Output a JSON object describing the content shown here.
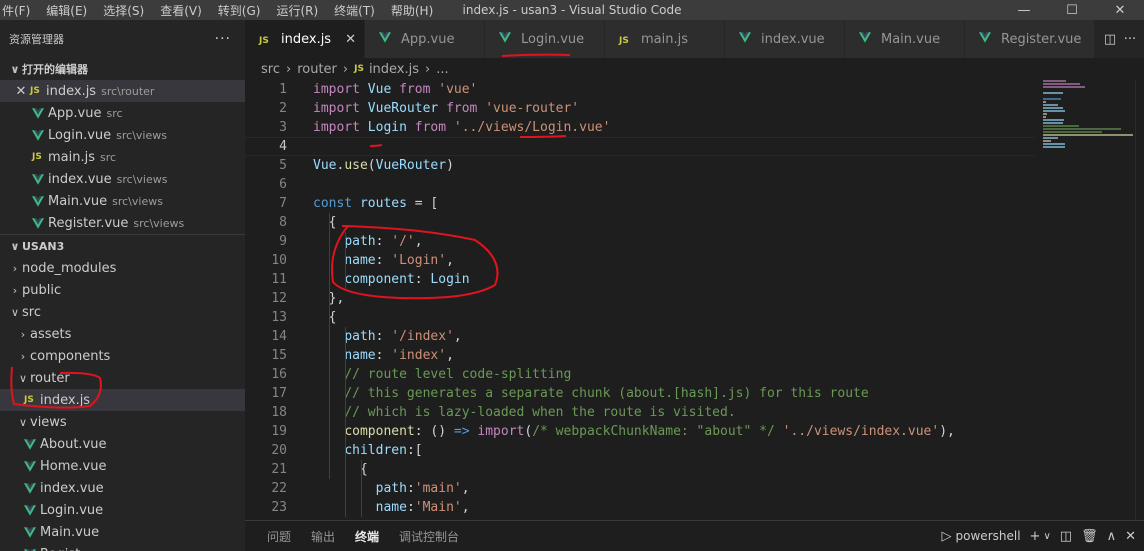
{
  "titlebar": {
    "menu": [
      "件(F)",
      "编辑(E)",
      "选择(S)",
      "查看(V)",
      "转到(G)",
      "运行(R)",
      "终端(T)",
      "帮助(H)"
    ],
    "title": "index.js - usan3 - Visual Studio Code",
    "minimize_icon": "minimize-icon",
    "maximize_icon": "maximize-icon",
    "close_icon": "close-icon"
  },
  "sidebar": {
    "title": "资源管理器",
    "more": "···",
    "open_editors_title": "打开的编辑器",
    "open_editors": [
      {
        "name": "index.js",
        "desc": "src\\router",
        "type": "js"
      },
      {
        "name": "App.vue",
        "desc": "src",
        "type": "vue"
      },
      {
        "name": "Login.vue",
        "desc": "src\\views",
        "type": "vue"
      },
      {
        "name": "main.js",
        "desc": "src",
        "type": "js"
      },
      {
        "name": "index.vue",
        "desc": "src\\views",
        "type": "vue"
      },
      {
        "name": "Main.vue",
        "desc": "src\\views",
        "type": "vue"
      },
      {
        "name": "Register.vue",
        "desc": "src\\views",
        "type": "vue"
      }
    ],
    "project_title": "USAN3",
    "tree": [
      {
        "name": "node_modules",
        "kind": "folder",
        "indent": 0
      },
      {
        "name": "public",
        "kind": "folder",
        "indent": 0
      },
      {
        "name": "src",
        "kind": "folder-open",
        "indent": 0
      },
      {
        "name": "assets",
        "kind": "folder",
        "indent": 1
      },
      {
        "name": "components",
        "kind": "folder",
        "indent": 1
      },
      {
        "name": "router",
        "kind": "folder-open",
        "indent": 1
      },
      {
        "name": "index.js",
        "kind": "js",
        "indent": 2
      },
      {
        "name": "views",
        "kind": "folder-open",
        "indent": 1
      },
      {
        "name": "About.vue",
        "kind": "vue",
        "indent": 2
      },
      {
        "name": "Home.vue",
        "kind": "vue",
        "indent": 2
      },
      {
        "name": "index.vue",
        "kind": "vue",
        "indent": 2
      },
      {
        "name": "Login.vue",
        "kind": "vue",
        "indent": 2
      },
      {
        "name": "Main.vue",
        "kind": "vue",
        "indent": 2
      },
      {
        "name": "Regist...",
        "kind": "vue",
        "indent": 2
      }
    ]
  },
  "tabs": [
    {
      "label": "index.js",
      "type": "js",
      "active": true
    },
    {
      "label": "App.vue",
      "type": "vue"
    },
    {
      "label": "Login.vue",
      "type": "vue"
    },
    {
      "label": "main.js",
      "type": "js"
    },
    {
      "label": "index.vue",
      "type": "vue"
    },
    {
      "label": "Main.vue",
      "type": "vue"
    },
    {
      "label": "Register.vue",
      "type": "vue"
    }
  ],
  "breadcrumb": {
    "parts": [
      "src",
      "router"
    ],
    "file": "index.js",
    "tail": "..."
  },
  "editor": {
    "lines": [
      [
        [
          "kw2",
          "import"
        ],
        [
          "punc",
          " "
        ],
        [
          "var",
          "Vue"
        ],
        [
          "punc",
          " "
        ],
        [
          "kw2",
          "from"
        ],
        [
          "punc",
          " "
        ],
        [
          "str",
          "'vue'"
        ]
      ],
      [
        [
          "kw2",
          "import"
        ],
        [
          "punc",
          " "
        ],
        [
          "var",
          "VueRouter"
        ],
        [
          "punc",
          " "
        ],
        [
          "kw2",
          "from"
        ],
        [
          "punc",
          " "
        ],
        [
          "str",
          "'vue-router'"
        ]
      ],
      [
        [
          "kw2",
          "import"
        ],
        [
          "punc",
          " "
        ],
        [
          "var",
          "Login"
        ],
        [
          "punc",
          " "
        ],
        [
          "kw2",
          "from"
        ],
        [
          "punc",
          " "
        ],
        [
          "str",
          "'../views/Login.vue'"
        ]
      ],
      [],
      [
        [
          "var",
          "Vue"
        ],
        [
          "punc",
          "."
        ],
        [
          "fn",
          "use"
        ],
        [
          "punc",
          "("
        ],
        [
          "var",
          "VueRouter"
        ],
        [
          "punc",
          ")"
        ]
      ],
      [],
      [
        [
          "kw",
          "const"
        ],
        [
          "punc",
          " "
        ],
        [
          "var",
          "routes"
        ],
        [
          "punc",
          " = ["
        ]
      ],
      [
        [
          "punc",
          "  {"
        ]
      ],
      [
        [
          "punc",
          "    "
        ],
        [
          "var",
          "path"
        ],
        [
          "punc",
          ": "
        ],
        [
          "str",
          "'/'"
        ],
        [
          "punc",
          ","
        ]
      ],
      [
        [
          "punc",
          "    "
        ],
        [
          "var",
          "name"
        ],
        [
          "punc",
          ": "
        ],
        [
          "str",
          "'Login'"
        ],
        [
          "punc",
          ","
        ]
      ],
      [
        [
          "punc",
          "    "
        ],
        [
          "var",
          "component"
        ],
        [
          "punc",
          ": "
        ],
        [
          "var",
          "Login"
        ]
      ],
      [
        [
          "punc",
          "  },"
        ]
      ],
      [
        [
          "punc",
          "  {"
        ]
      ],
      [
        [
          "punc",
          "    "
        ],
        [
          "var",
          "path"
        ],
        [
          "punc",
          ": "
        ],
        [
          "str",
          "'/index'"
        ],
        [
          "punc",
          ","
        ]
      ],
      [
        [
          "punc",
          "    "
        ],
        [
          "var",
          "name"
        ],
        [
          "punc",
          ": "
        ],
        [
          "str",
          "'index'"
        ],
        [
          "punc",
          ","
        ]
      ],
      [
        [
          "punc",
          "    "
        ],
        [
          "com",
          "// route level code-splitting"
        ]
      ],
      [
        [
          "punc",
          "    "
        ],
        [
          "com",
          "// this generates a separate chunk (about.[hash].js) for this route"
        ]
      ],
      [
        [
          "punc",
          "    "
        ],
        [
          "com",
          "// which is lazy-loaded when the route is visited."
        ]
      ],
      [
        [
          "punc",
          "    "
        ],
        [
          "fn",
          "component"
        ],
        [
          "punc",
          ": () "
        ],
        [
          "kw",
          "=>"
        ],
        [
          "punc",
          " "
        ],
        [
          "kw2",
          "import"
        ],
        [
          "punc",
          "("
        ],
        [
          "com",
          "/* webpackChunkName: \"about\" */"
        ],
        [
          "punc",
          " "
        ],
        [
          "str",
          "'../views/index.vue'"
        ],
        [
          "punc",
          "),"
        ]
      ],
      [
        [
          "punc",
          "    "
        ],
        [
          "var",
          "children"
        ],
        [
          "punc",
          ":["
        ]
      ],
      [
        [
          "punc",
          "      {"
        ]
      ],
      [
        [
          "punc",
          "        "
        ],
        [
          "var",
          "path"
        ],
        [
          "punc",
          ":"
        ],
        [
          "str",
          "'main'"
        ],
        [
          "punc",
          ","
        ]
      ],
      [
        [
          "punc",
          "        "
        ],
        [
          "var",
          "name"
        ],
        [
          "punc",
          ":"
        ],
        [
          "str",
          "'Main'"
        ],
        [
          "punc",
          ","
        ]
      ]
    ]
  },
  "panel": {
    "tabs": [
      "问题",
      "输出",
      "终端",
      "调试控制台"
    ],
    "active": "终端",
    "terminal_name": "powershell"
  },
  "colors": {
    "vue_green": "#41b883",
    "js_yellow": "#cbcb41",
    "annotation_red": "#e0141e"
  }
}
